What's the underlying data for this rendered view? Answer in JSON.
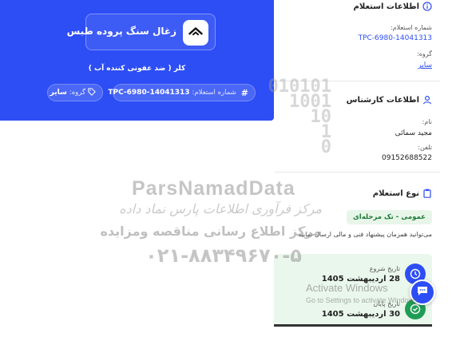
{
  "header": {
    "brand_name": "زغال سنگ پروده طبس",
    "subtitle": "کلر ( ضد عفونی کننده آب )",
    "tender_label": "شماره استعلام:",
    "tender_number": "TPC-6980-14041313",
    "group_label": "گروه:",
    "group_value": "سایر"
  },
  "info": {
    "title": "اطلاعات استعلام",
    "number_label": "شماره استعلام:",
    "number_value": "TPC-6980-14041313",
    "group_label": "گروه:",
    "group_value": "سایر"
  },
  "expert": {
    "title": "اطلاعات کارشناس",
    "name_label": "نام:",
    "name_value": "مجید سمائی",
    "phone_label": "تلفن:",
    "phone_value": "09152688522"
  },
  "type": {
    "title": "نوع استعلام",
    "badge": "عمومی - تک مرحله‌ای",
    "description": "می‌توانید همزمان پیشنهاد فنی و مالی ارسال نمایید"
  },
  "dates": {
    "start_label": "تاریخ شروع",
    "start_value": "28 اردیبهشت 1405",
    "end_label": "تاریخ پایان",
    "end_value": "30 اردیبهشت 1405"
  },
  "watermark": {
    "digits_1": "010101",
    "digits_2": "1001",
    "digits_3": "10",
    "digits_4": "1",
    "digits_5": "0",
    "brand": "ParsNamadData",
    "line_fa_1": "مرکز فرآوری اطلاعات پارس نماد داده",
    "line_fa_2": "مرکز اطلاع رسانی مناقصه ومزایده",
    "phone": "۰۲۱-۸۸۳۴۹۶۷۰-۵"
  },
  "os_overlay": {
    "activate_title": "Activate Windows",
    "activate_sub": "Go to Settings to activate Windows."
  },
  "colors": {
    "primary": "#2d4ef5",
    "success_bg": "#e8f6ea",
    "success_text": "#1f7a35",
    "end_circle": "#1f9d55"
  },
  "icons": {
    "brand": "roof-logo-icon",
    "tender": "hash-icon",
    "group": "tag-icon",
    "info": "info-circle-icon",
    "expert": "user-icon",
    "type": "clipboard-icon",
    "start": "clock-icon",
    "end": "check-circle-icon",
    "chat": "chat-icon"
  }
}
